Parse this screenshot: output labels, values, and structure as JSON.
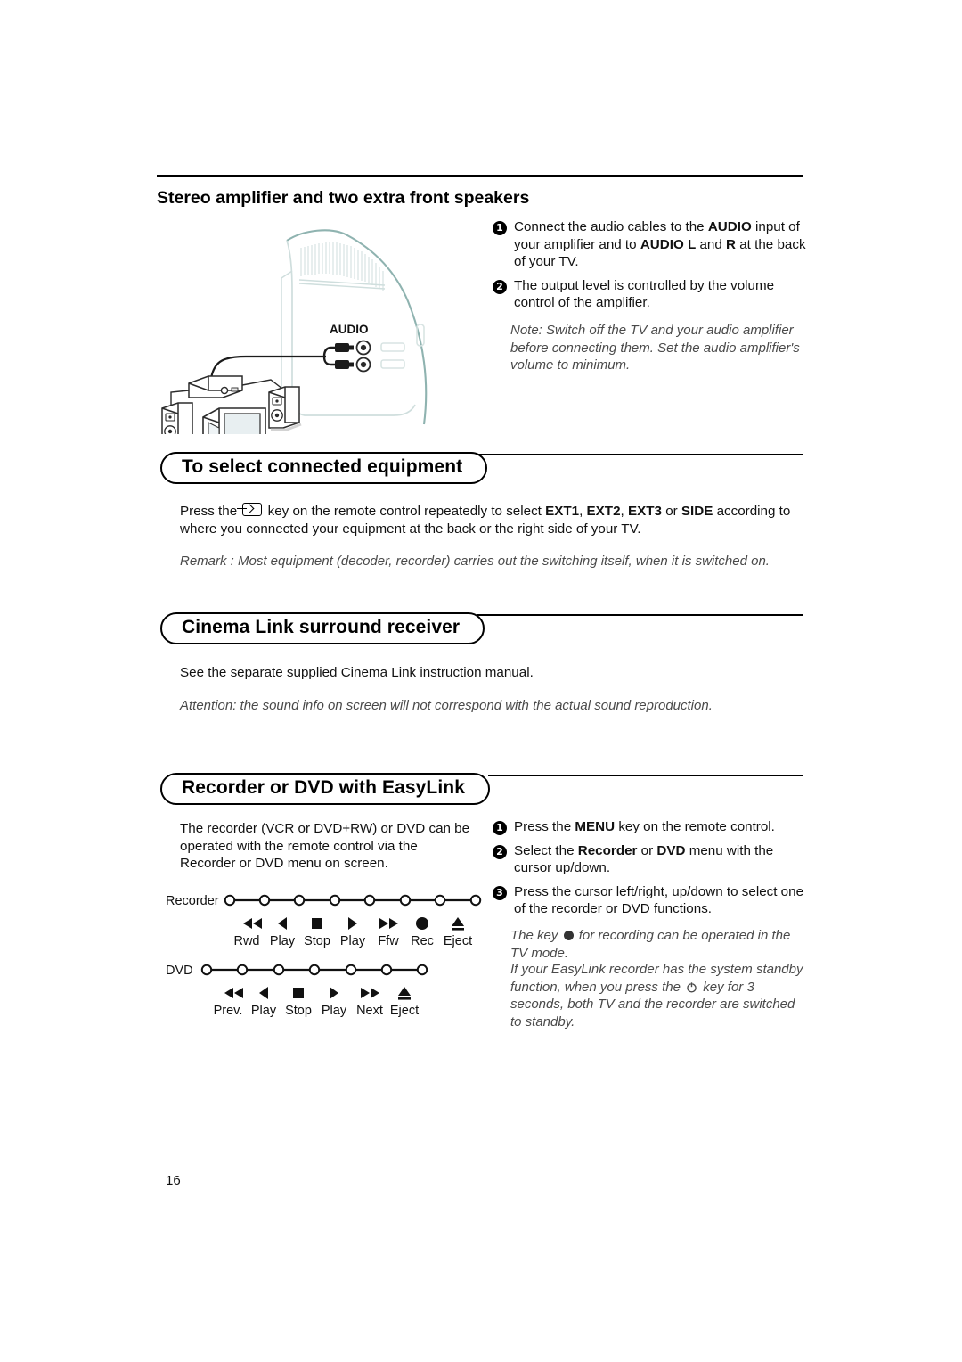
{
  "page": {
    "number": "16"
  },
  "section_amplifier": {
    "heading": "Stereo amplifier and two extra front speakers",
    "steps": [
      {
        "num": "1",
        "parts": [
          {
            "t": "Connect the audio cables to the ",
            "b": false
          },
          {
            "t": "AUDIO",
            "b": true
          },
          {
            "t": " input of your amplifier and to ",
            "b": false
          },
          {
            "t": "AUDIO L",
            "b": true
          },
          {
            "t": " and ",
            "b": false
          },
          {
            "t": "R",
            "b": true
          },
          {
            "t": " at the back of your TV.",
            "b": false
          }
        ]
      },
      {
        "num": "2",
        "parts": [
          {
            "t": "The output level is controlled by the volume control of the amplifier.",
            "b": false
          }
        ]
      }
    ],
    "note": "Note: Switch off the TV and your audio amplifier before connecting them. Set the audio amplifier's volume to minimum.",
    "diagram": {
      "audio_label": "AUDIO",
      "jack_count": 2,
      "devices": [
        "amplifier",
        "left-speaker",
        "right-speaker",
        "television"
      ]
    }
  },
  "section_select": {
    "heading": "To select connected equipment",
    "body_before_icon": "Press the ",
    "icon_name": "source-key-icon",
    "body_after_icon_1": " key on the remote control repeatedly to select ",
    "sources": [
      "EXT1",
      "EXT2",
      "EXT3",
      "SIDE"
    ],
    "sources_joiner_1": ", ",
    "sources_joiner_last": " or ",
    "body_after_sources": " according to where you connected your equipment at the back or the right side of your TV.",
    "remark": "Remark : Most equipment (decoder, recorder) carries out the switching itself, when it is switched on."
  },
  "section_cinema": {
    "heading": "Cinema Link surround receiver",
    "body": "See the separate supplied Cinema Link instruction manual.",
    "attention": "Attention: the sound info on screen will not correspond with the actual sound reproduction."
  },
  "section_easylink": {
    "heading": "Recorder or DVD with EasyLink",
    "left_paragraph": "The recorder (VCR or DVD+RW) or DVD can be operated with the remote control via the Recorder or DVD menu on screen.",
    "steps": [
      {
        "num": "1",
        "parts": [
          {
            "t": "Press the ",
            "b": false
          },
          {
            "t": "MENU",
            "b": true
          },
          {
            "t": " key on the remote control.",
            "b": false
          }
        ]
      },
      {
        "num": "2",
        "parts": [
          {
            "t": "Select the ",
            "b": false
          },
          {
            "t": "Recorder",
            "b": true
          },
          {
            "t": " or ",
            "b": false
          },
          {
            "t": "DVD",
            "b": true
          },
          {
            "t": " menu with the cursor up/down.",
            "b": false
          }
        ]
      },
      {
        "num": "3",
        "parts": [
          {
            "t": "Press the cursor left/right, up/down to select one of the recorder or DVD functions.",
            "b": false
          }
        ]
      }
    ],
    "note_1_before": "The key ",
    "note_1_after": " for recording can be operated in the TV mode.",
    "note_2_before": "If your EasyLink recorder has the system standby function, when you press the ",
    "note_2_after": " key for 3 seconds, both TV and the recorder are switched to standby.",
    "recorder_row": {
      "label": "Recorder",
      "nodes": 8,
      "functions": [
        {
          "icon": "rewind",
          "label": "Rwd"
        },
        {
          "icon": "play-reverse",
          "label": "Play"
        },
        {
          "icon": "stop",
          "label": "Stop"
        },
        {
          "icon": "play",
          "label": "Play"
        },
        {
          "icon": "fast-forward",
          "label": "Ffw"
        },
        {
          "icon": "record",
          "label": "Rec"
        },
        {
          "icon": "eject",
          "label": "Eject"
        }
      ]
    },
    "dvd_row": {
      "label": "DVD",
      "nodes": 7,
      "functions": [
        {
          "icon": "previous",
          "label": "Prev."
        },
        {
          "icon": "play-reverse",
          "label": "Play"
        },
        {
          "icon": "stop",
          "label": "Stop"
        },
        {
          "icon": "play",
          "label": "Play"
        },
        {
          "icon": "next",
          "label": "Next"
        },
        {
          "icon": "eject",
          "label": "Eject"
        }
      ]
    }
  },
  "colors": {
    "ink": "#111111",
    "rule": "#000000",
    "note_gray": "#4a4a4a",
    "diagram_outline": "#2b2b2b",
    "diagram_teal": "#8fb3b0"
  }
}
